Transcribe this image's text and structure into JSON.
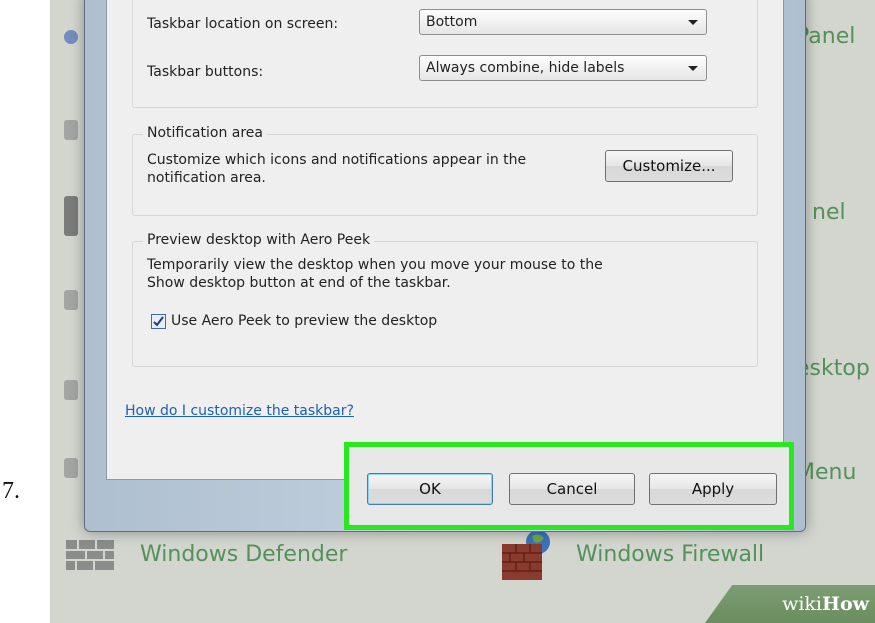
{
  "step_number": "7.",
  "background": {
    "panel_right_1": "Panel",
    "panel_right_2": "nel",
    "panel_right_3": "esktop",
    "panel_right_4": "Menu",
    "defender_label": "Windows Defender",
    "firewall_label": "Windows Firewall",
    "label_color": "#54915a"
  },
  "taskbar": {
    "location_label": "Taskbar location on screen:",
    "location_value": "Bottom",
    "buttons_label": "Taskbar buttons:",
    "buttons_value": "Always combine, hide labels"
  },
  "notification_area": {
    "title": "Notification area",
    "description_line1": "Customize which icons and notifications appear in the",
    "description_line2": "notification area.",
    "customize_button": "Customize..."
  },
  "aero_peek": {
    "title": "Preview desktop with Aero Peek",
    "description_line1": "Temporarily view the desktop when you move your mouse to the",
    "description_line2": "Show desktop button at end of the taskbar.",
    "checkbox_label": "Use Aero Peek to preview the desktop",
    "checkbox_checked": true
  },
  "help_link": "How do I customize the taskbar?",
  "buttons": {
    "ok": "OK",
    "cancel": "Cancel",
    "apply": "Apply"
  },
  "highlight_color": "#28e81f",
  "watermark": {
    "wiki": "wiki",
    "how": "How"
  }
}
